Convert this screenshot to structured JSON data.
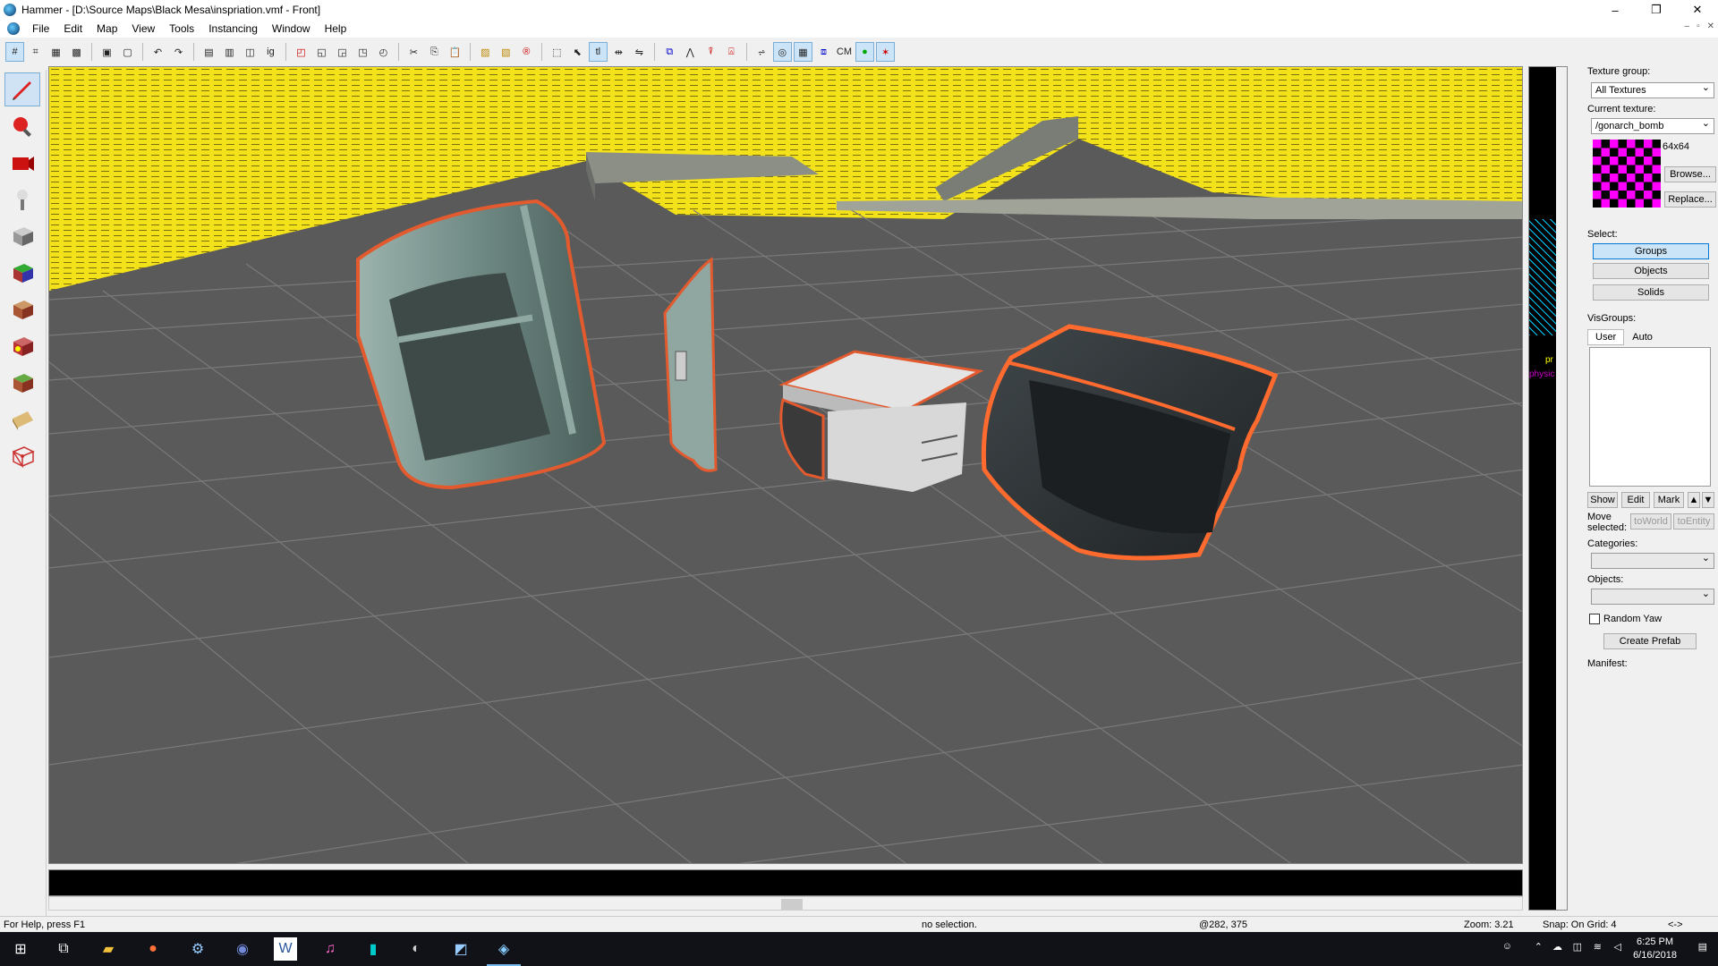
{
  "window": {
    "title": "Hammer - [D:\\Source Maps\\Black Mesa\\inspriation.vmf - Front]",
    "controls": {
      "minimize": "–",
      "maximize": "❐",
      "close": "✕"
    }
  },
  "menu": [
    "File",
    "Edit",
    "Map",
    "View",
    "Tools",
    "Instancing",
    "Window",
    "Help"
  ],
  "mdi_controls": {
    "minimize": "–",
    "restore": "▫",
    "close": "✕"
  },
  "toolbar": {
    "cm_label": "CM"
  },
  "right_panel": {
    "texture_group_label": "Texture group:",
    "texture_group_value": "All Textures",
    "current_texture_label": "Current texture:",
    "current_texture_value": "/gonarch_bomb",
    "texture_size": "64x64",
    "browse_label": "Browse...",
    "replace_label": "Replace...",
    "select_label": "Select:",
    "select_groups": "Groups",
    "select_objects": "Objects",
    "select_solids": "Solids",
    "visgroups_label": "VisGroups:",
    "tab_user": "User",
    "tab_auto": "Auto",
    "show_label": "Show",
    "edit_label": "Edit",
    "mark_label": "Mark",
    "move_selected_label": "Move selected:",
    "to_world_label": "toWorld",
    "to_entity_label": "toEntity",
    "categories_label": "Categories:",
    "objects_label": "Objects:",
    "random_yaw_label": "Random Yaw",
    "create_prefab_label": "Create Prefab",
    "manifest_label": "Manifest:"
  },
  "side2d": {
    "physics_text": "physic",
    "pr_text": "pr"
  },
  "status": {
    "help": "For Help, press F1",
    "selection": "no selection.",
    "coords": "@282, 375",
    "zoom": "Zoom: 3.21",
    "snap": "Snap: On Grid: 4",
    "arrows": "<->"
  },
  "taskbar": {
    "time": "6:25 PM",
    "date": "6/16/2018"
  }
}
